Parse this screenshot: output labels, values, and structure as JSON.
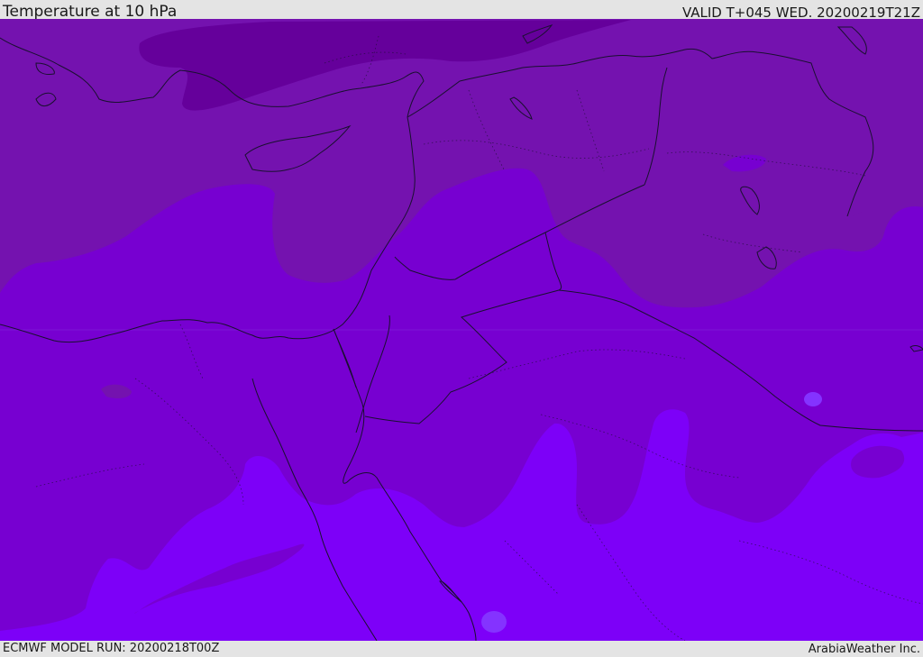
{
  "header": {
    "title": "Temperature at 10 hPa",
    "valid": "VALID T+045 WED. 20200219T21Z"
  },
  "footer": {
    "model_run": "ECMWF MODEL RUN: 20200218T00Z",
    "credit": "ArabiaWeather Inc."
  },
  "map": {
    "field": "temperature",
    "level": "10 hPa",
    "shading_colors": {
      "darkest": "#65009b",
      "dark": "#7412af",
      "medium": "#7700d1",
      "light": "#7d00f8",
      "lightest": "#8433ff"
    },
    "border_color": "#1a1030"
  }
}
